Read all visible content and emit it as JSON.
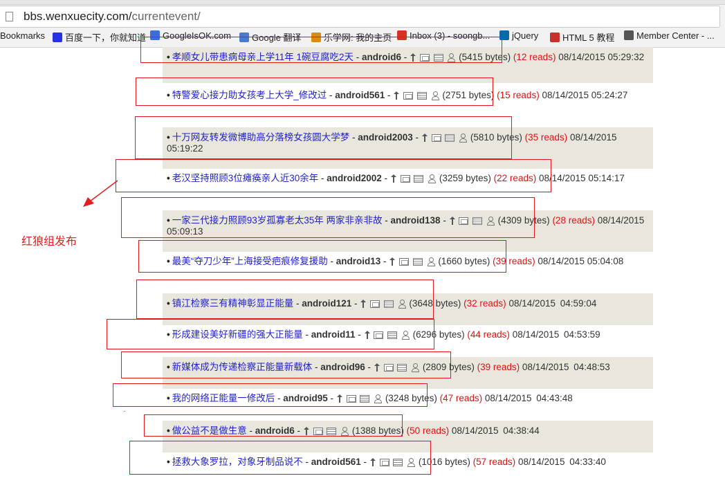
{
  "browser": {
    "url_host": "bbs.wenxuecity.com/",
    "url_path": "currentevent/",
    "bookmarks": [
      {
        "label": "Bookmarks",
        "icon": "none",
        "color": ""
      },
      {
        "label": "百度一下，你就知道",
        "icon": "baidu-paw-icon",
        "color": "#2932e1"
      },
      {
        "label": "GoogleIsOK.com",
        "icon": "globe-icon",
        "color": "#3a6fd8"
      },
      {
        "label": "Google 翻译",
        "icon": "translate-icon",
        "color": "#4a7bd0"
      },
      {
        "label": "乐学网: 我的主页",
        "icon": "lexue-icon",
        "color": "#d88a1a"
      },
      {
        "label": "Inbox (3) - soongb...",
        "icon": "gmail-icon",
        "color": "#d93025"
      },
      {
        "label": "jQuery",
        "icon": "jquery-icon",
        "color": "#0769ad"
      },
      {
        "label": "HTML 5 教程",
        "icon": "w3school-icon",
        "color": "#c9302c"
      },
      {
        "label": "Member Center - ...",
        "icon": "apple-icon",
        "color": "#555555"
      }
    ]
  },
  "posts": [
    {
      "title": "孝顺女儿带患病母亲上学11年 1碗豆腐吃2天",
      "author": "android6",
      "bytes": "(5415 bytes)",
      "reads": "(12 reads)",
      "date": "08/14/2015",
      "time": "05:29:32"
    },
    {
      "title": "特警爱心接力助女孩考上大学_修改过",
      "author": "android561",
      "bytes": "(2751 bytes)",
      "reads": "(15 reads)",
      "date": "08/14/2015",
      "time": "05:24:27"
    },
    {
      "title": "十万网友转发微博助高分落榜女孩圆大学梦",
      "author": "android2003",
      "bytes": "(5810 bytes)",
      "reads": "(35 reads)",
      "date": "08/14/2015",
      "time": "05:19:22"
    },
    {
      "title": "老汉坚持照顾3位瘫痪亲人近30余年",
      "author": "android2002",
      "bytes": "(3259 bytes)",
      "reads": "(22 reads)",
      "date": "08/14/2015",
      "time": "05:14:17"
    },
    {
      "title": "一家三代接力照顾93岁孤寡老太35年 两家非亲非故",
      "author": "android138",
      "bytes": "(4309 bytes)",
      "reads": "(28 reads)",
      "date": "08/14/2015",
      "time": "05:09:13"
    },
    {
      "title": "最美“夺刀少年”上海接受疤痕修复援助",
      "author": "android13",
      "bytes": "(1660 bytes)",
      "reads": "(39 reads)",
      "date": "08/14/2015",
      "time": "05:04:08"
    },
    {
      "title": "镇江检察三有精神彰显正能量",
      "author": "android121",
      "bytes": "(3648 bytes)",
      "reads": "(32 reads)",
      "date": "08/14/2015",
      "time": "04:59:04"
    },
    {
      "title": "形成建设美好新疆的强大正能量",
      "author": "android11",
      "bytes": "(6296 bytes)",
      "reads": "(44 reads)",
      "date": "08/14/2015",
      "time": "04:53:59"
    },
    {
      "title": "新媒体成为传递检察正能量新载体",
      "author": "android96",
      "bytes": "(2809 bytes)",
      "reads": "(39 reads)",
      "date": "08/14/2015",
      "time": "04:48:53"
    },
    {
      "title": "我的网络正能量一修改后",
      "author": "android95",
      "bytes": "(3248 bytes)",
      "reads": "(47 reads)",
      "date": "08/14/2015",
      "time": "04:43:48"
    },
    {
      "title": "做公益不是做生意",
      "author": "android6",
      "bytes": "(1388 bytes)",
      "reads": "(50 reads)",
      "date": "08/14/2015",
      "time": "04:38:44"
    },
    {
      "title": "拯救大象罗拉，对象牙制品说不",
      "author": "android561",
      "bytes": "(1016 bytes)",
      "reads": "(57 reads)",
      "date": "08/14/2015",
      "time": "04:33:40"
    }
  ],
  "annotation": {
    "label": "红狼组发布",
    "color": "#e02020"
  },
  "colors": {
    "link": "#2222cc",
    "reads": "#e01010",
    "row_shade": "#e8e6dd",
    "box": "#e8141c"
  }
}
